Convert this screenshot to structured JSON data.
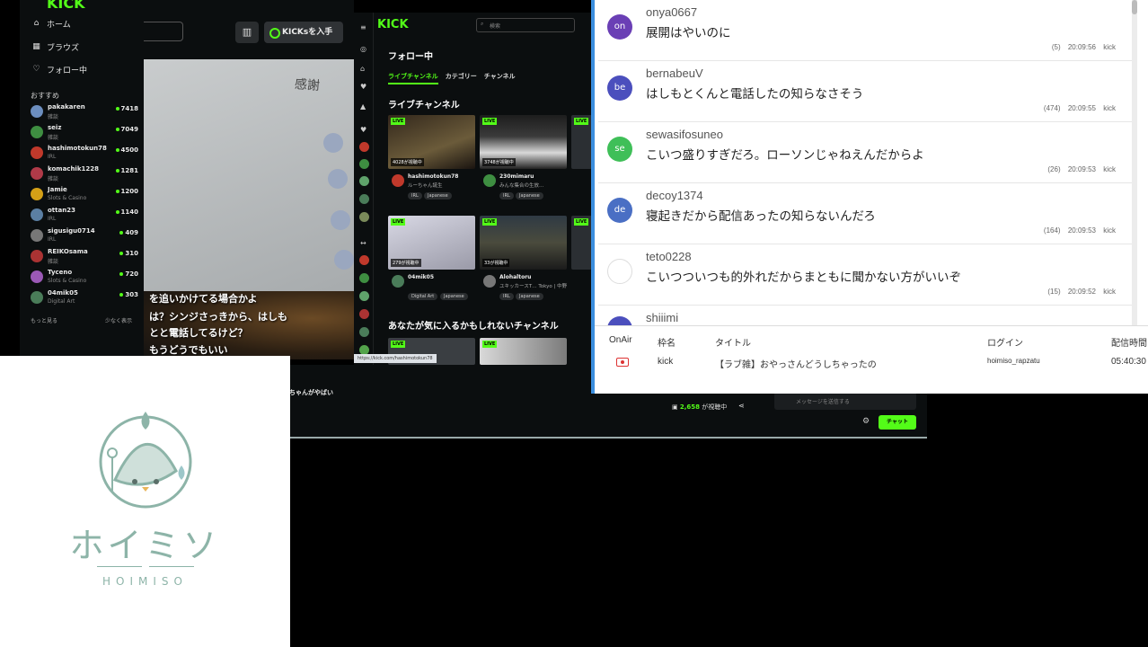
{
  "left_window": {
    "logo": "KICK",
    "nav": [
      {
        "icon": "home-icon",
        "label": "ホーム"
      },
      {
        "icon": "browse-icon",
        "label": "ブラウズ"
      },
      {
        "icon": "heart-icon",
        "label": "フォロー中"
      }
    ],
    "recommended_heading": "おすすめ",
    "recommended": [
      {
        "name": "pakakaren",
        "category": "雑談",
        "viewers": "7418",
        "color": "#6c8ebf"
      },
      {
        "name": "seiz",
        "category": "雑談",
        "viewers": "7049",
        "color": "#3e8e41"
      },
      {
        "name": "hashimotokun78",
        "category": "IRL",
        "viewers": "4500",
        "color": "#c0392b"
      },
      {
        "name": "komachik1228",
        "category": "雑談",
        "viewers": "1281",
        "color": "#b03a48"
      },
      {
        "name": "Jamie",
        "category": "Slots & Casino",
        "viewers": "1200",
        "color": "#d4a017"
      },
      {
        "name": "ottan23",
        "category": "IRL",
        "viewers": "1140",
        "color": "#5b7fa3"
      },
      {
        "name": "sigusigu0714",
        "category": "IRL",
        "viewers": "409",
        "color": "#777"
      },
      {
        "name": "REIKOsama",
        "category": "雑談",
        "viewers": "310",
        "color": "#a33"
      },
      {
        "name": "Tyceno",
        "category": "Slots & Casino",
        "viewers": "720",
        "color": "#9b59b6"
      },
      {
        "name": "04mik05",
        "category": "Digital Art",
        "viewers": "303",
        "color": "#4a7c59"
      }
    ],
    "show_more": "もっと見る",
    "show_less": "少なく表示",
    "kicks_button": "KICKsを入手",
    "video": {
      "paper_heading": "感謝",
      "subtitles": [
        "を追いかけてる場合かよ",
        "は？シンジさっきから、はしも",
        "とと電話してるけど？",
        "もうどうでもいい"
      ]
    }
  },
  "middle_window": {
    "logo": "KICK",
    "search_placeholder": "検索",
    "title": "フォロー中",
    "tabs": [
      "ライブチャンネル",
      "カテゴリー",
      "チャンネル"
    ],
    "live_section": "ライブチャンネル",
    "suggest_section": "あなたが気に入るかもしれないチャンネル",
    "live_label": "LIVE",
    "cards": [
      {
        "viewers": "4028が視聴中",
        "name": "hashimotokun78",
        "desc": "ルーちゃん誕生",
        "tags": [
          "IRL",
          "Japanese"
        ]
      },
      {
        "viewers": "3748が視聴中",
        "name": "230mimaru",
        "desc": "みんな集合の生放…",
        "tags": [
          "IRL",
          "Japanese"
        ]
      },
      {
        "viewers": "279が視聴中",
        "name": "04mik05",
        "desc": "",
        "tags": [
          "Digital Art",
          "Japanese"
        ]
      },
      {
        "viewers": "33が視聴中",
        "name": "Alohaltoru",
        "desc": "ユキッカースT…  Tokyo | 中野",
        "tags": [
          "IRL",
          "Japanese"
        ]
      }
    ],
    "url_tooltip": "https://kick.com/hashimotokun78"
  },
  "bottom_bar": {
    "title": "ちゃんがやばい",
    "watching_count": "2,658",
    "watching_label": "が視聴中",
    "message_placeholder": "メッセージを送信する",
    "chat_button": "チャット"
  },
  "comment_viewer": {
    "comments": [
      {
        "avatar": "on",
        "avatar_color": "#6a3fb5",
        "user": "onya0667",
        "message": "展開はやいのに",
        "count": "(5)",
        "time": "20:09:56",
        "service": "kick"
      },
      {
        "avatar": "be",
        "avatar_color": "#4b4fbd",
        "user": "bernabeuV",
        "message": "はしもとくんと電話したの知らなさそう",
        "count": "(474)",
        "time": "20:09:55",
        "service": "kick"
      },
      {
        "avatar": "se",
        "avatar_color": "#3fbf58",
        "user": "sewasifosuneo",
        "message": "こいつ盛りすぎだろ。ローソンじゃねえんだからよ",
        "count": "(26)",
        "time": "20:09:53",
        "service": "kick"
      },
      {
        "avatar": "de",
        "avatar_color": "#4a6fc4",
        "user": "decoy1374",
        "message": "寝起きだから配信あったの知らないんだろ",
        "count": "(164)",
        "time": "20:09:53",
        "service": "kick"
      },
      {
        "avatar": "",
        "avatar_color": "#ffffff",
        "user": "teto0228",
        "message": "こいつついつも的外れだからまともに聞かない方がいいぞ",
        "count": "(15)",
        "time": "20:09:52",
        "service": "kick"
      }
    ],
    "partial_user": "shiiimi",
    "table": {
      "headers": [
        "OnAir",
        "枠名",
        "タイトル",
        "ログイン",
        "配信時間"
      ],
      "row": {
        "service": "kick",
        "title": "【ラブ雑】おやっさんどうしちゃったの",
        "login": "hoimiso_rapzatu",
        "duration": "05:40:30"
      }
    }
  },
  "logo_box": {
    "jp": "ホイミソ",
    "en": "HOIMISO"
  }
}
